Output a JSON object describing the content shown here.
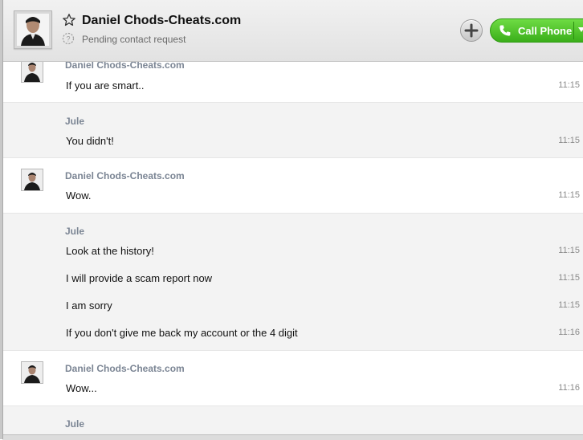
{
  "header": {
    "contact_name": "Daniel Chods-Cheats.com",
    "status": "Pending contact request",
    "call_label": "Call Phone",
    "icons": {
      "favorite": "star-icon",
      "status": "pending-icon",
      "add": "plus-icon",
      "call": "phone-icon",
      "menu": "chevron-down-icon"
    },
    "colors": {
      "call_button": "#3aae1a",
      "sender_name": "#7b8594"
    }
  },
  "messages": {
    "g1": {
      "sender": "Daniel Chods-Cheats.com",
      "m1": {
        "text": "If you are smart..",
        "time": "11:15"
      }
    },
    "g2": {
      "sender": "Jule",
      "m1": {
        "text": "You didn't!",
        "time": "11:15"
      }
    },
    "g3": {
      "sender": "Daniel Chods-Cheats.com",
      "m1": {
        "text": "Wow.",
        "time": "11:15"
      }
    },
    "g4": {
      "sender": "Jule",
      "m1": {
        "text": "Look at the history!",
        "time": "11:15"
      },
      "m2": {
        "text": "I will provide a scam report now",
        "time": "11:15"
      },
      "m3": {
        "text": "I am sorry",
        "time": "11:15"
      },
      "m4": {
        "text": "If you don't give me back my account or the 4 digit",
        "time": "11:16"
      }
    },
    "g5": {
      "sender": "Daniel Chods-Cheats.com",
      "m1": {
        "text": "Wow...",
        "time": "11:16"
      }
    },
    "g6": {
      "sender": "Jule"
    }
  }
}
